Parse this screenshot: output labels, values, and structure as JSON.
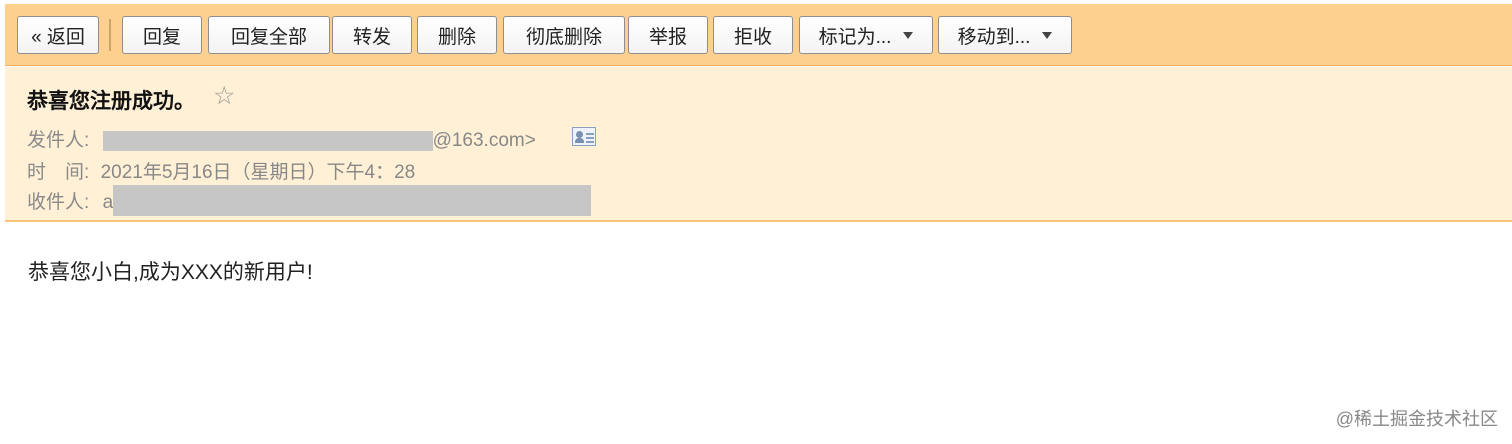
{
  "toolbar": {
    "back": "« 返回",
    "reply": "回复",
    "reply_all": "回复全部",
    "forward": "转发",
    "delete": "删除",
    "delete_permanently": "彻底删除",
    "report": "举报",
    "reject": "拒收",
    "mark_as": "标记为...",
    "move_to": "移动到..."
  },
  "email": {
    "subject": "恭喜您注册成功。",
    "star": "☆",
    "from_label": "发件人:",
    "from_value_suffix": "@163.com>",
    "time_label": "时　间:",
    "time_value": "2021年5月16日（星期日）下午4：28",
    "to_label": "收件人:",
    "to_value_prefix": "a",
    "body": "恭喜您小白,成为XXX的新用户!"
  },
  "watermark": "@稀土掘金技术社区",
  "icons": {
    "contact_card": "contact-card-icon",
    "dropdown": "caret-down-icon"
  },
  "colors": {
    "toolbar_bg": "#fdd08f",
    "header_bg": "#fff0d6",
    "header_border": "#f6c674"
  }
}
